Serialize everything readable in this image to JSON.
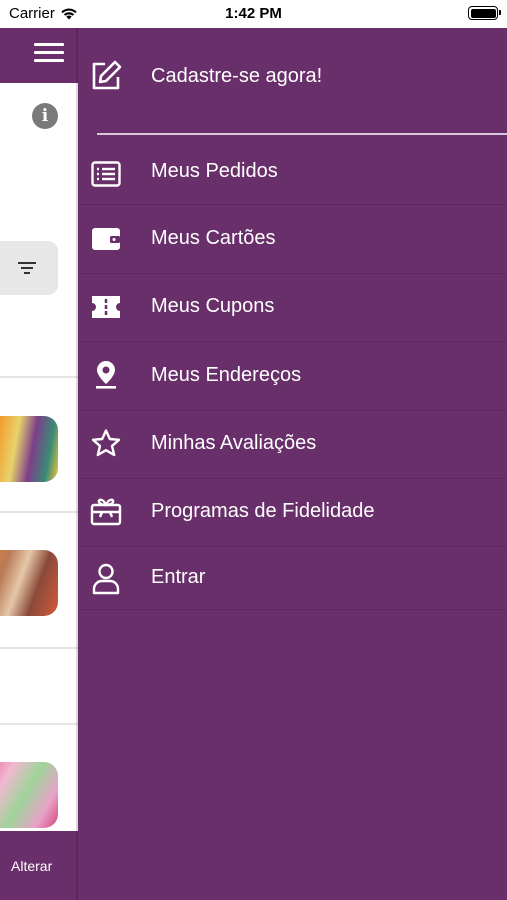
{
  "status_bar": {
    "carrier": "Carrier",
    "time": "1:42 PM"
  },
  "background_app": {
    "footer_button": "Alterar"
  },
  "drawer": {
    "items": [
      {
        "label": "Cadastre-se agora!",
        "icon": "edit-icon"
      },
      {
        "label": "Meus Pedidos",
        "icon": "list-icon"
      },
      {
        "label": "Meus Cartões",
        "icon": "wallet-icon"
      },
      {
        "label": "Meus Cupons",
        "icon": "ticket-icon"
      },
      {
        "label": "Meus Endereços",
        "icon": "location-pin-icon"
      },
      {
        "label": "Minhas Avaliações",
        "icon": "star-icon"
      },
      {
        "label": "Programas de Fidelidade",
        "icon": "gift-icon"
      },
      {
        "label": "Entrar",
        "icon": "user-icon"
      }
    ]
  },
  "colors": {
    "drawer_bg": "#692f6a",
    "header_bg": "#6a2f6a",
    "text": "#ffffff"
  }
}
